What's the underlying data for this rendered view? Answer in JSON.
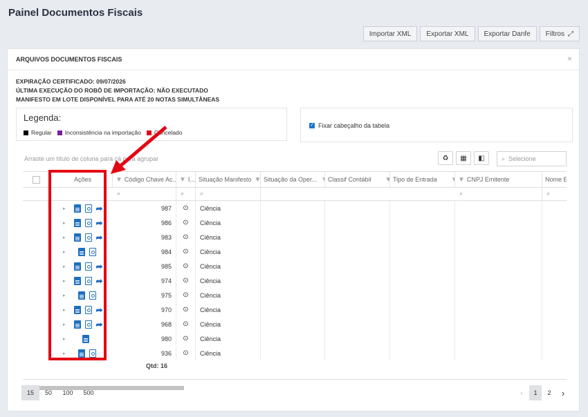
{
  "page": {
    "title": "Painel Documentos Fiscais"
  },
  "toolbar": {
    "importar_xml": "Importar XML",
    "exportar_xml": "Exportar XML",
    "exportar_danfe": "Exportar Danfe",
    "filtros": "Filtros"
  },
  "card": {
    "title": "ARQUIVOS DOCUMENTOS FISCAIS",
    "close": "×",
    "info": [
      "EXPIRAÇÃO CERTIFICADO: 09/07/2026",
      "ÚLTIMA EXECUÇÃO DO ROBÔ DE IMPORTAÇÃO: NÃO EXECUTADO",
      "MANIFESTO EM LOTE DISPONÍVEL PARA ATÉ 20 NOTAS SIMULTÂNEAS"
    ]
  },
  "legend": {
    "title": "Legenda:",
    "items": [
      {
        "label": "Regular",
        "color": "#000000"
      },
      {
        "label": "Inconsistência na importação",
        "color": "#7b1fa2"
      },
      {
        "label": "Cancelado",
        "color": "#e30613"
      }
    ]
  },
  "fix_header": {
    "label": "Fixar cabeçalho da tabela",
    "checked": true
  },
  "grid": {
    "grouping_hint": "Arraste um título de coluna para cá para agrupar",
    "search_placeholder": "Selecione",
    "headers": [
      "Ações",
      "Código Chave Ac...",
      "I...",
      "Situação Manifesto",
      "Situação da Oper...",
      "Classif Contábil",
      "Tipo de Entrada",
      "CNPJ Emitente",
      "Nome E"
    ],
    "rows": [
      {
        "code": "987",
        "situacao": "Ciência",
        "share": true,
        "pdf": true
      },
      {
        "code": "986",
        "situacao": "Ciência",
        "share": true,
        "pdf": true
      },
      {
        "code": "983",
        "situacao": "Ciência",
        "share": true,
        "pdf": true
      },
      {
        "code": "984",
        "situacao": "Ciência",
        "share": false,
        "pdf": true
      },
      {
        "code": "985",
        "situacao": "Ciência",
        "share": true,
        "pdf": true
      },
      {
        "code": "974",
        "situacao": "Ciência",
        "share": true,
        "pdf": true
      },
      {
        "code": "975",
        "situacao": "Ciência",
        "share": false,
        "pdf": true
      },
      {
        "code": "970",
        "situacao": "Ciência",
        "share": true,
        "pdf": true
      },
      {
        "code": "968",
        "situacao": "Ciência",
        "share": true,
        "pdf": true
      },
      {
        "code": "980",
        "situacao": "Ciência",
        "share": false,
        "pdf": false
      },
      {
        "code": "936",
        "situacao": "Ciência",
        "share": false,
        "pdf": true
      }
    ],
    "qtd": "Qtd: 16"
  },
  "pager": {
    "sizes": [
      "15",
      "50",
      "100",
      "500"
    ],
    "selected_size": "15",
    "pages": [
      "1",
      "2"
    ],
    "current_page": "1"
  },
  "colors": {
    "accent": "#1e6fc0",
    "highlight": "#e30613"
  }
}
